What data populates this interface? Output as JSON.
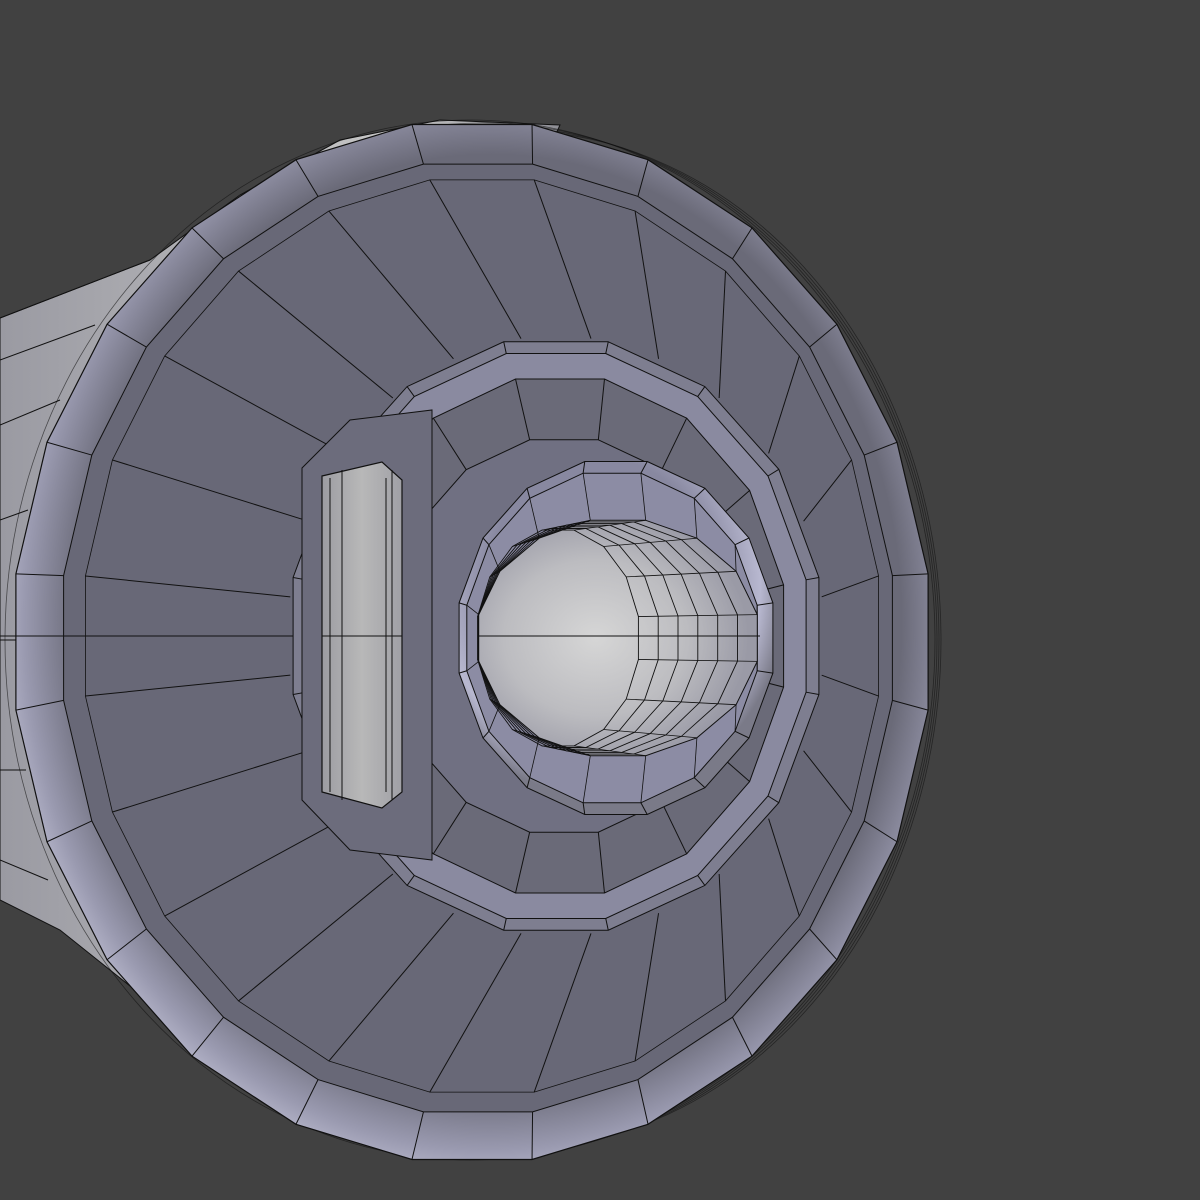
{
  "viewport": {
    "background_color": "#414141",
    "wire_color": "#111111",
    "face_colors": {
      "front_face": "#686877",
      "rim_light": "#b8b8cc",
      "rim_dark": "#55555f",
      "barrel_light": "#c6c6c6",
      "barrel_mid": "#8e8e95",
      "bore_dark": "#6f6f78",
      "bore_light": "#dcdcdc",
      "boss_face": "#6a6a78",
      "key_slot": "#b3b3b3"
    },
    "mesh": {
      "outer_ring_segments": 24,
      "boss_segments": 16,
      "bore_segments": 16,
      "bore_depth_rings": 6
    }
  }
}
